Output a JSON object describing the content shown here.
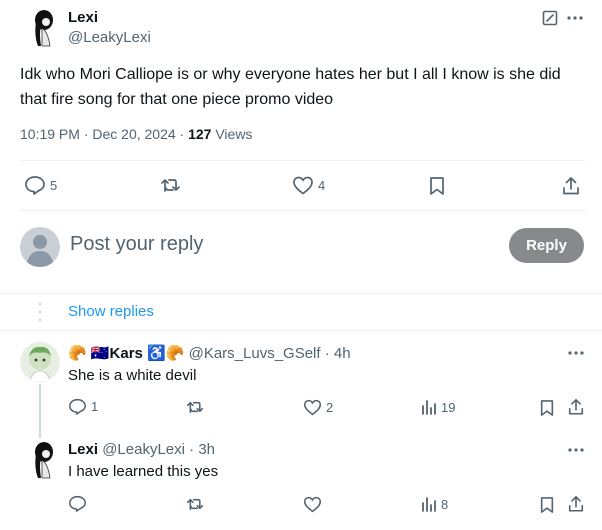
{
  "tweet": {
    "author_name": "Lexi",
    "author_handle": "@LeakyLexi",
    "text": "Idk who Mori Calliope is or why everyone hates her but I all I know is she did that fire song for that one piece promo video",
    "time": "10:19 PM · Dec 20, 2024 · ",
    "views_count": "127",
    "views_label": " Views",
    "actions": {
      "replies": "5",
      "retweets": "",
      "likes": "4"
    }
  },
  "composer": {
    "placeholder": "Post your reply",
    "reply_label": "Reply"
  },
  "thread": {
    "show_replies": "Show replies"
  },
  "reply1": {
    "name_prefix": "🥐 🇦🇺",
    "name": "Kars",
    "name_suffix": "♿🥐",
    "handle": "@Kars_Luvs_GSelf",
    "sep": " · ",
    "time": "4h",
    "text": "She is a white devil",
    "replies": "1",
    "likes": "2",
    "views": "19"
  },
  "reply2": {
    "name": "Lexi",
    "handle": "@LeakyLexi",
    "sep": " · ",
    "time": "3h",
    "text": "I have learned this yes",
    "views": "8"
  },
  "colors": {
    "accent": "#1d9bf0",
    "muted": "#536471",
    "reply_button": "#87898c",
    "divider": "#eff3f4"
  }
}
